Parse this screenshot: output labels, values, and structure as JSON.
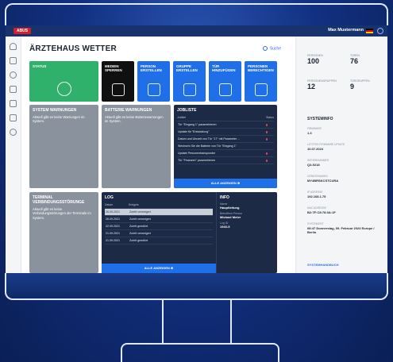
{
  "header": {
    "logo": "ABUS",
    "user": "Max Mustermann"
  },
  "page": {
    "title": "ÄRZTEHAUS WETTER",
    "search_label": "Suche"
  },
  "tiles": [
    {
      "label": "STATUS",
      "color": "#2fb06b"
    },
    {
      "label": "MEDIEN SPERREN",
      "color": "#101010"
    },
    {
      "label": "PERSON ERSTELLEN",
      "color": "#1f6fe8"
    },
    {
      "label": "GRUPPE ERSTELLEN",
      "color": "#1f6fe8"
    },
    {
      "label": "TÜR HINZUFÜGEN",
      "color": "#1f6fe8"
    },
    {
      "label": "PERSONEN BERECHTIGEN",
      "color": "#1f6fe8"
    }
  ],
  "system_warnings": {
    "title": "SYSTEM WARNUNGEN",
    "text": "Aktuell gibt es keine Warnungen im System."
  },
  "battery_warnings": {
    "title": "BATTERIE WARNUNGEN",
    "text": "Aktuell gibt es keine Batteriewarnungen im System."
  },
  "terminal": {
    "title": "TERMINAL VERBINDUNGSSTÖRUNGE",
    "text": "Aktuell gibt es keine Verbindungsstörungen der Terminals im System."
  },
  "joblist": {
    "title": "JOBLISTE",
    "col_job": "Jobtitel",
    "col_status": "Status",
    "rows": [
      "Tür \"Eingang 1\" parametrieren",
      "Update für \"Entwicklung\"",
      "Datum und Uhrzeit von Tür \"17\" mit Parameter ...",
      "Wechseln Sie die Batterie von Tür \"Eingang 1\"",
      "Update Personentransponder",
      "Tür \"Finanzen\" parametrieren"
    ],
    "all_label": "ALLE ANZEIGEN"
  },
  "log": {
    "title": "LOG",
    "col_date": "Datum",
    "col_event": "Ereignis",
    "rows": [
      {
        "date": "26.09.2021",
        "event": "Zutritt verweigert"
      },
      {
        "date": "26.09.2021",
        "event": "Zutritt verweigert"
      },
      {
        "date": "22.09.2021",
        "event": "Zutritt gewährt"
      },
      {
        "date": "21.09.2021",
        "event": "Zutritt verweigert"
      },
      {
        "date": "21.09.2021",
        "event": "Zutritt gewährt"
      }
    ],
    "all_label": "ALLE ANZEIGEN"
  },
  "info": {
    "title": "INFO",
    "name_label": "Name",
    "name_value": "Hauptleitung",
    "person_label": "Betroffene Person",
    "person_value": "Michael Meier",
    "log_label": "Log ID",
    "log_value": "1943-5"
  },
  "stats": [
    {
      "label": "PERSONEN",
      "value": "100"
    },
    {
      "label": "TÜREN",
      "value": "76"
    },
    {
      "label": "PERSONENGRUPPEN",
      "value": "12"
    },
    {
      "label": "TÜRGRUPPEN",
      "value": "9"
    }
  ],
  "sysinfo": {
    "title": "SYSTEMINFO",
    "items": [
      {
        "label": "FIRMWARE",
        "value": "1.3"
      },
      {
        "label": "LETZTES FIRMWARE UPDATE",
        "value": "10.07.2024"
      },
      {
        "label": "SERIENNUMMER",
        "value": "Q3-9218"
      },
      {
        "label": "GERÄTENAMEN",
        "value": "MY4BRSKCSTCURA"
      },
      {
        "label": "IP ADRESSE",
        "value": "192.168.1.75"
      },
      {
        "label": "MAC ADRESSE",
        "value": "B2:7F:C8:78:3A:1F"
      },
      {
        "label": "SYSTEMZEIT",
        "value": "08:47 Donnerstag, 09. Februar 2024 Europe / Berlin"
      }
    ],
    "manual": "SYSTEMHANDBUCH"
  }
}
